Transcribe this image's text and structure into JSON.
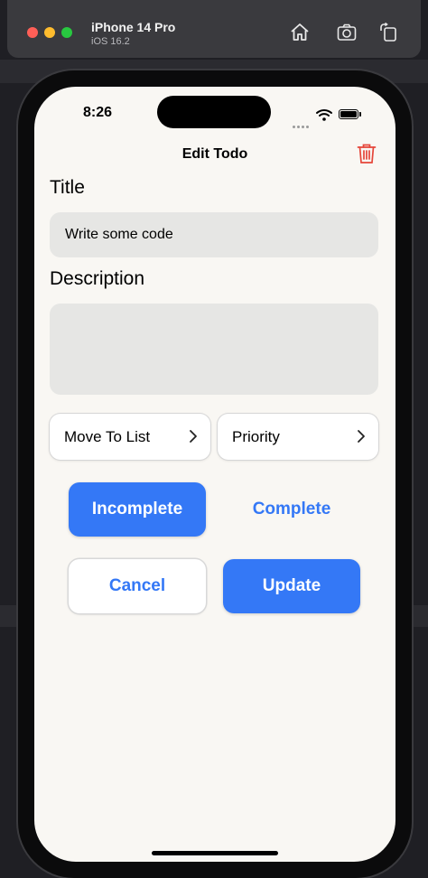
{
  "simulator": {
    "device_name": "iPhone 14 Pro",
    "os_version": "iOS 16.2",
    "icons": [
      "home-icon",
      "screenshot-icon",
      "rotate-icon"
    ]
  },
  "status_bar": {
    "time": "8:26",
    "icons": [
      "cellular-icon",
      "wifi-icon",
      "battery-icon"
    ]
  },
  "nav": {
    "title": "Edit Todo",
    "delete_icon": "trash-icon",
    "delete_color": "#e5463a"
  },
  "form": {
    "title_label": "Title",
    "title_value": "Write some code",
    "description_label": "Description",
    "description_value": "",
    "move_to_list_label": "Move To List",
    "priority_label": "Priority"
  },
  "status_toggle": {
    "incomplete_label": "Incomplete",
    "complete_label": "Complete",
    "selected": "Incomplete"
  },
  "actions": {
    "cancel_label": "Cancel",
    "update_label": "Update"
  },
  "colors": {
    "accent": "#3478f6",
    "background": "#f9f7f3",
    "field": "#e6e6e4"
  }
}
